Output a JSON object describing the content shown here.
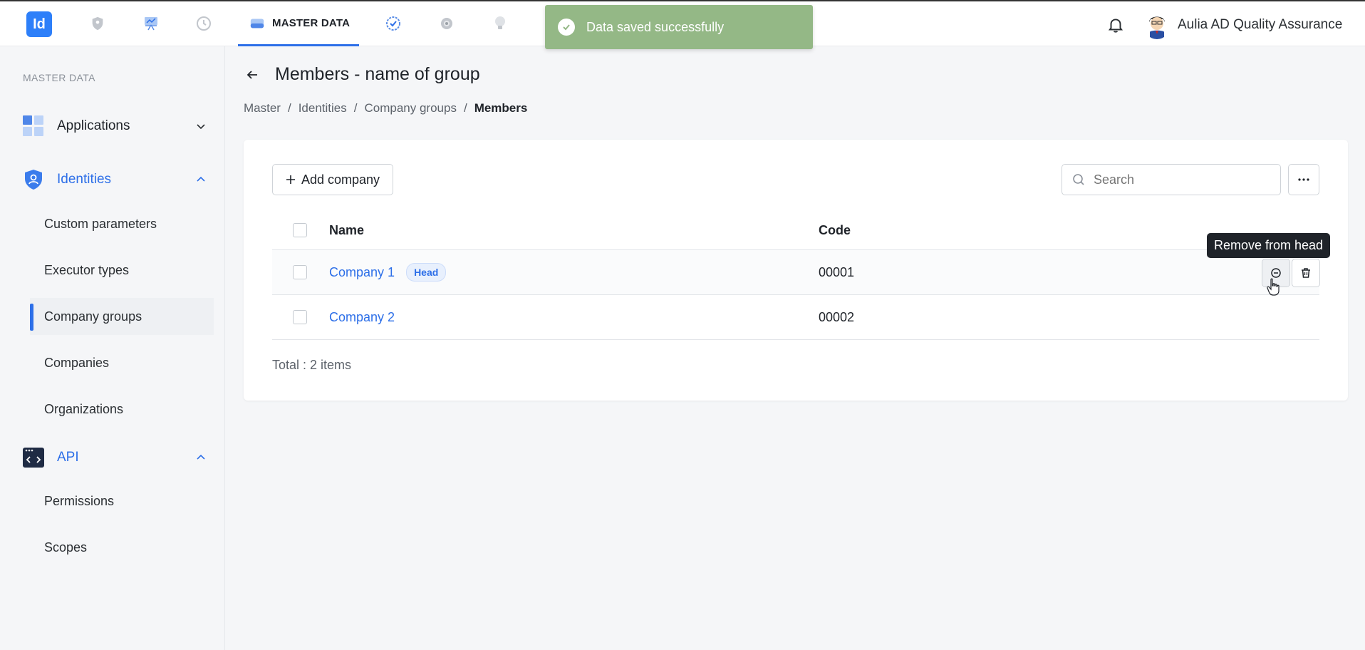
{
  "topbar": {
    "logo_text": "Id",
    "active_tab_label": "MASTER DATA",
    "nav_icons": [
      "shield-icon",
      "presentation-icon",
      "history-icon",
      "check-badge-icon",
      "gear-icon",
      "lightbulb-icon"
    ],
    "user_name": "Aulia AD Quality Assurance"
  },
  "toast": {
    "message": "Data saved successfully",
    "color": "#94b886"
  },
  "sidebar": {
    "heading": "MASTER DATA",
    "groups": [
      {
        "label": "Applications",
        "expanded": false,
        "icon": "apps-grid-icon"
      },
      {
        "label": "Identities",
        "expanded": true,
        "icon": "identity-shield-icon"
      },
      {
        "label": "API",
        "expanded": true,
        "icon": "code-window-icon"
      }
    ],
    "identities_items": [
      "Custom parameters",
      "Executor types",
      "Company groups",
      "Companies",
      "Organizations"
    ],
    "api_items": [
      "Permissions",
      "Scopes"
    ],
    "active_item": "Company groups"
  },
  "page": {
    "title": "Members - name of group",
    "breadcrumb": [
      "Master",
      "Identities",
      "Company groups",
      "Members"
    ]
  },
  "toolbar": {
    "add_label": "Add company",
    "search_placeholder": "Search"
  },
  "table": {
    "columns": [
      "Name",
      "Code"
    ],
    "rows": [
      {
        "name": "Company 1",
        "badge": "Head",
        "code": "00001"
      },
      {
        "name": "Company 2",
        "badge": "",
        "code": "00002"
      }
    ],
    "total_label": "Total : 2 items"
  },
  "tooltip": {
    "text": "Remove from head"
  },
  "colors": {
    "accent": "#2d6fe8",
    "logo": "#2d7ff9"
  }
}
